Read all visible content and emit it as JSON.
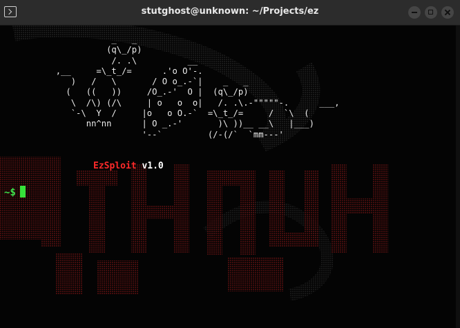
{
  "window": {
    "title": "stutghost@unknown: ~/Projects/ez"
  },
  "terminal": {
    "ascii_art": "                      _   _\n                     (q\\_/p)\n                      /. .\\          __\n           ,__     =\\_t_/=      .'o O'-.\n              )   /   \\       / O o_.-`|    _   _\n             (   ((   ))     /O_.-'  O |  (q\\_/p)\n              \\  /\\) (/\\     | o   o  o|   /. .\\.-\"\"\"\"\"-.      ___,\n              `-\\  Y  /     |o   o O.-`  =\\_t_/=     /  `\\  (\n                 nn^nn      | O _.-'       )\\ ))__ __\\   |___)\n                            '--`         (/-(/`  `mm---'",
    "banner_name": "EzSploit",
    "banner_version": "v1.0",
    "prompt": "~$"
  },
  "colors": {
    "prompt": "#3fe34c",
    "banner_name": "#ff2a2a",
    "background_art": "#4a0c0c"
  }
}
